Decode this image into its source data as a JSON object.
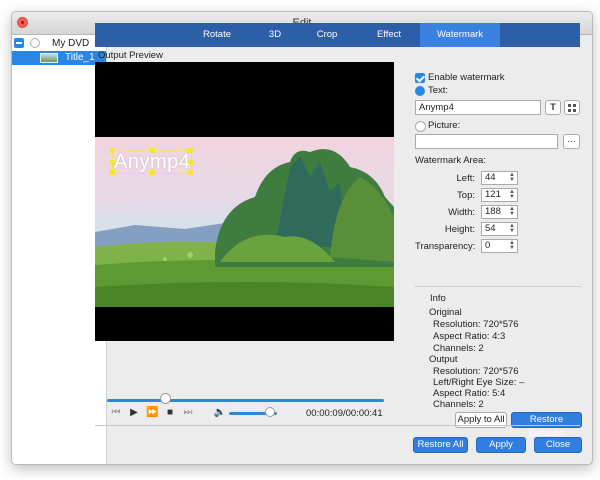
{
  "window": {
    "title": "Edit"
  },
  "sidebar": {
    "root_label": "My DVD",
    "child_label": "Title_1"
  },
  "tabs": [
    {
      "label": "Rotate",
      "active": false
    },
    {
      "label": "3D",
      "active": false
    },
    {
      "label": "Crop",
      "active": false
    },
    {
      "label": "Effect",
      "active": false
    },
    {
      "label": "Watermark",
      "active": true
    }
  ],
  "preview": {
    "label": "Output Preview",
    "watermark_text": "Anymp4",
    "progress_fraction": 0.21,
    "volume_fraction": 0.85,
    "timecode": "00:00:09/00:00:41"
  },
  "watermark": {
    "enable_label": "Enable watermark",
    "enabled": true,
    "text_label": "Text:",
    "text_value": "Anymp4",
    "font_button": "T",
    "picture_label": "Picture:",
    "picture_value": "",
    "browse_button": "···",
    "area_title": "Watermark Area:",
    "fields": [
      {
        "label": "Left:",
        "value": "44"
      },
      {
        "label": "Top:",
        "value": "121"
      },
      {
        "label": "Width:",
        "value": "188"
      },
      {
        "label": "Height:",
        "value": "54"
      },
      {
        "label": "Transparency:",
        "value": "0"
      }
    ]
  },
  "info": {
    "title": "Info",
    "original_title": "Original",
    "original_lines": [
      "Resolution: 720*576",
      "Aspect Ratio: 4:3",
      "Channels: 2"
    ],
    "output_title": "Output",
    "output_lines": [
      "Resolution: 720*576",
      "Left/Right Eye Size: –",
      "Aspect Ratio: 5:4",
      "Channels: 2"
    ]
  },
  "buttons": {
    "apply_to_all": "Apply to All",
    "restore_defaults": "Restore Defaults",
    "restore_all": "Restore All",
    "apply": "Apply",
    "close": "Close"
  },
  "colors": {
    "accent": "#2a86e4",
    "tabbar": "#2d5fa8",
    "watermark_frame": "#f5e23a"
  }
}
